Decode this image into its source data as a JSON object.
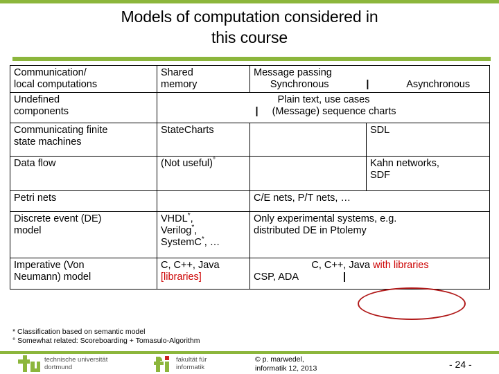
{
  "slide": {
    "title_line1": "Models of computation considered in",
    "title_line2": "this course",
    "accent_color": "#8CB63C",
    "highlight_color": "#CC0000"
  },
  "table": {
    "headers": {
      "col0_line1": "Communication/",
      "col0_line2": "local computations",
      "col1_line1": "Shared",
      "col1_line2": "memory",
      "message_passing": "Message passing",
      "synchronous": "Synchronous",
      "asynchronous": "Asynchronous",
      "divider": "|"
    },
    "rows": [
      {
        "label_line1": "Undefined",
        "label_line2": "components",
        "merged_line1": "Plain text, use cases",
        "merged_divider": "|",
        "merged_line2": "(Message) sequence charts"
      },
      {
        "label_line1": "Communicating finite",
        "label_line2": "state machines",
        "shared_memory": "StateCharts",
        "synchronous": "",
        "asynchronous": "SDL"
      },
      {
        "label_line1": "Data flow",
        "label_line2": "",
        "shared_memory": "(Not useful)",
        "shared_memory_mark": "°",
        "synchronous": "",
        "asynchronous_line1": "Kahn networks,",
        "asynchronous_line2": "SDF"
      },
      {
        "label_line1": "Petri nets",
        "shared_memory": "",
        "merged": "C/E nets, P/T nets, …"
      },
      {
        "label_line1": "Discrete event (DE)",
        "label_line2": "model",
        "sm_line1": "VHDL",
        "sm_line1_mark": "*",
        "sm_line1_tail": ",",
        "sm_line2": "Verilog",
        "sm_line2_mark": "*",
        "sm_line2_tail": ",",
        "sm_line3": "SystemC",
        "sm_line3_mark": "*",
        "sm_line3_tail": ", …",
        "merged_line1": "Only experimental systems, e.g.",
        "merged_line2": "distributed DE in Ptolemy"
      },
      {
        "label_line1": "Imperative (Von",
        "label_line2": "Neumann) model",
        "sm_line1": "C, C++, Java",
        "sm_line2": "[libraries]",
        "mp_line1_plain": "C, C++, Java",
        "mp_line1_red": "with libraries",
        "mp_line2": "CSP, ADA",
        "mp_line2_divider": "|"
      }
    ]
  },
  "footnotes": {
    "line1": "* Classification based on semantic model",
    "line2": "° Somewhat related: Scoreboarding + Tomasulo-Algorithm"
  },
  "footer": {
    "logo_tu_line1": "technische universität",
    "logo_tu_line2": "dortmund",
    "logo_fi_line1": "fakultät für",
    "logo_fi_line2": "informatik",
    "copyright_line1": "© p. marwedel,",
    "copyright_line2": "informatik 12,  2013",
    "page_number": "- 24 -"
  }
}
